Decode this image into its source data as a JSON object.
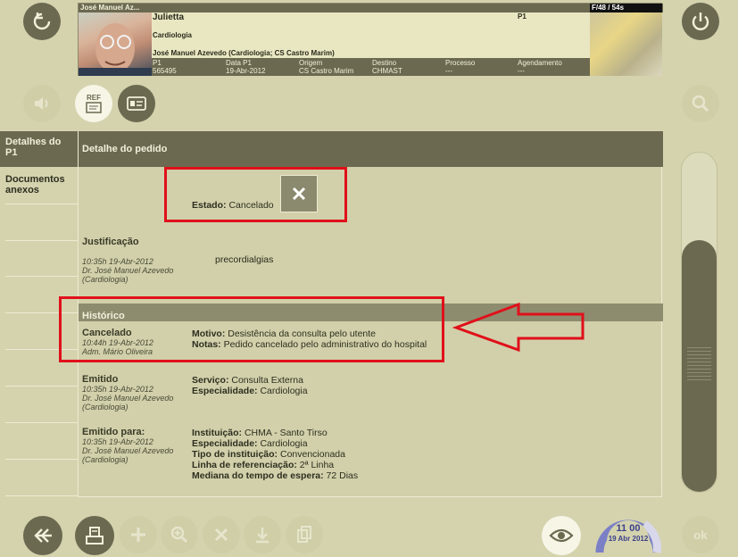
{
  "patient": {
    "name_short": "José Manuel Az...",
    "episode_label": "Julietta",
    "specialty": "Cardiologia",
    "doctor_line": "José Manuel Azevedo (Cardiologia; CS Castro Marim)",
    "p1_tag": "P1",
    "fields": [
      {
        "label": "P1",
        "value": "565495"
      },
      {
        "label": "Data P1",
        "value": "19-Abr-2012"
      },
      {
        "label": "Origem",
        "value": "CS Castro Marim"
      },
      {
        "label": "Destino",
        "value": "CHMAST"
      },
      {
        "label": "Processo",
        "value": "---"
      },
      {
        "label": "Agendamento",
        "value": "---"
      }
    ],
    "age_tag": "F/48 / 54s"
  },
  "toolbar": {
    "ref_label": "REF"
  },
  "sidebar": {
    "items": [
      {
        "label": "Detalhes do P1"
      },
      {
        "label": "Documentos anexos"
      }
    ]
  },
  "main": {
    "header": "Detalhe do pedido",
    "estado_label": "Estado:",
    "estado_value": "Cancelado",
    "justificacao": {
      "title": "Justificação",
      "date": "10:35h 19-Abr-2012",
      "author": "Dr. José Manuel Azevedo",
      "dept": "(Cardiologia)",
      "text": "precordialgias"
    },
    "historico": {
      "title": "Histórico",
      "entries": [
        {
          "status": "Cancelado",
          "date": "10:44h 19-Abr-2012",
          "author": "Adm. Mário Oliveira",
          "dept": "",
          "details": [
            {
              "k": "Motivo:",
              "v": "Desistência da consulta pelo utente"
            },
            {
              "k": "Notas:",
              "v": "Pedido cancelado pelo administrativo do hospital"
            }
          ]
        },
        {
          "status": "Emitido",
          "date": "10:35h 19-Abr-2012",
          "author": "Dr. José Manuel Azevedo",
          "dept": "(Cardiologia)",
          "details": [
            {
              "k": "Serviço:",
              "v": "Consulta Externa"
            },
            {
              "k": "Especialidade:",
              "v": "Cardiologia"
            }
          ]
        },
        {
          "status": "Emitido para:",
          "date": "10:35h 19-Abr-2012",
          "author": "Dr. José Manuel Azevedo",
          "dept": "(Cardiologia)",
          "details": [
            {
              "k": "Instituição:",
              "v": "CHMA - Santo Tirso"
            },
            {
              "k": "Especialidade:",
              "v": "Cardiologia"
            },
            {
              "k": "Tipo de instituição:",
              "v": "Convencionada"
            },
            {
              "k": "Linha de referenciação:",
              "v": "2ª Linha"
            },
            {
              "k": "Mediana do tempo de espera:",
              "v": "72 Dias"
            }
          ]
        }
      ]
    }
  },
  "clock": {
    "time": "11 00",
    "date": "19 Abr 2012"
  },
  "ok_label": "ok",
  "colors": {
    "annotation": "#e0101a",
    "panel_dark": "#6b6950",
    "background": "#d4d3ae"
  }
}
